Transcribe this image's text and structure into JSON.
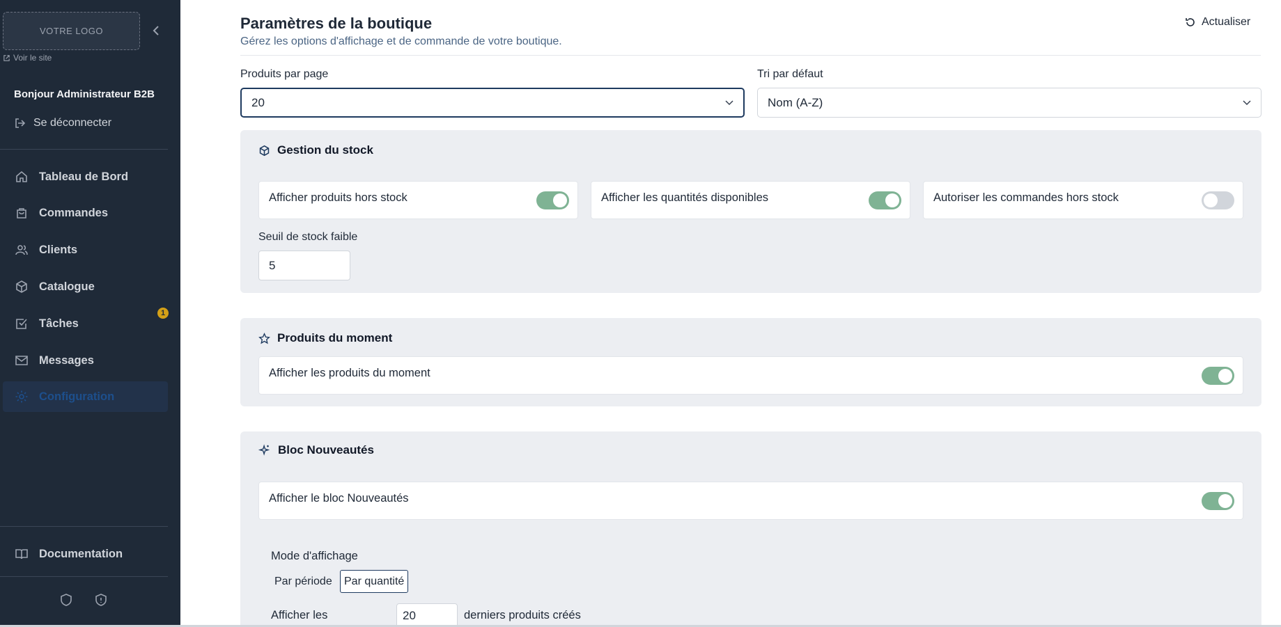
{
  "sidebar": {
    "logo_text": "VOTRE LOGO",
    "voir_site": "Voir le site",
    "greeting": "Bonjour Administrateur B2B",
    "logout": "Se déconnecter",
    "items": [
      {
        "label": "Tableau de Bord",
        "icon": "home-icon"
      },
      {
        "label": "Commandes",
        "icon": "shopping-bag-icon"
      },
      {
        "label": "Clients",
        "icon": "users-icon"
      },
      {
        "label": "Catalogue",
        "icon": "package-icon"
      },
      {
        "label": "Tâches",
        "icon": "checkbox-icon",
        "badge": "1"
      },
      {
        "label": "Messages",
        "icon": "mail-icon"
      },
      {
        "label": "Configuration",
        "icon": "gear-icon",
        "active": true
      }
    ],
    "documentation": "Documentation"
  },
  "header": {
    "title": "Paramètres de la boutique",
    "subtitle": "Gérez les options d'affichage et de commande de votre boutique.",
    "refresh": "Actualiser"
  },
  "settings": {
    "per_page_label": "Produits par page",
    "per_page_value": "20",
    "sort_label": "Tri par défaut",
    "sort_value": "Nom (A-Z)"
  },
  "stock": {
    "title": "Gestion du stock",
    "toggles": [
      {
        "label": "Afficher produits hors stock",
        "on": true
      },
      {
        "label": "Afficher les quantités disponibles",
        "on": true
      },
      {
        "label": "Autoriser les commandes hors stock",
        "on": false
      }
    ],
    "threshold_label": "Seuil de stock faible",
    "threshold_value": "5"
  },
  "moment": {
    "title": "Produits du moment",
    "toggle_label": "Afficher les produits du moment",
    "on": true
  },
  "nouveautes": {
    "title": "Bloc Nouveautés",
    "toggle_label": "Afficher le bloc Nouveautés",
    "on": true,
    "mode_label": "Mode d'affichage",
    "mode_options": [
      "Par période",
      "Par quantité"
    ],
    "mode_selected": "Par quantité",
    "count_prefix": "Afficher les",
    "count_value": "20",
    "count_suffix": "derniers produits créés"
  },
  "colors": {
    "sidebar_bg": "#1f2a38",
    "toggle_on": "#7fb394",
    "toggle_off": "#d1d5db",
    "badge": "#d4a017",
    "accent": "#1e3a5f"
  }
}
